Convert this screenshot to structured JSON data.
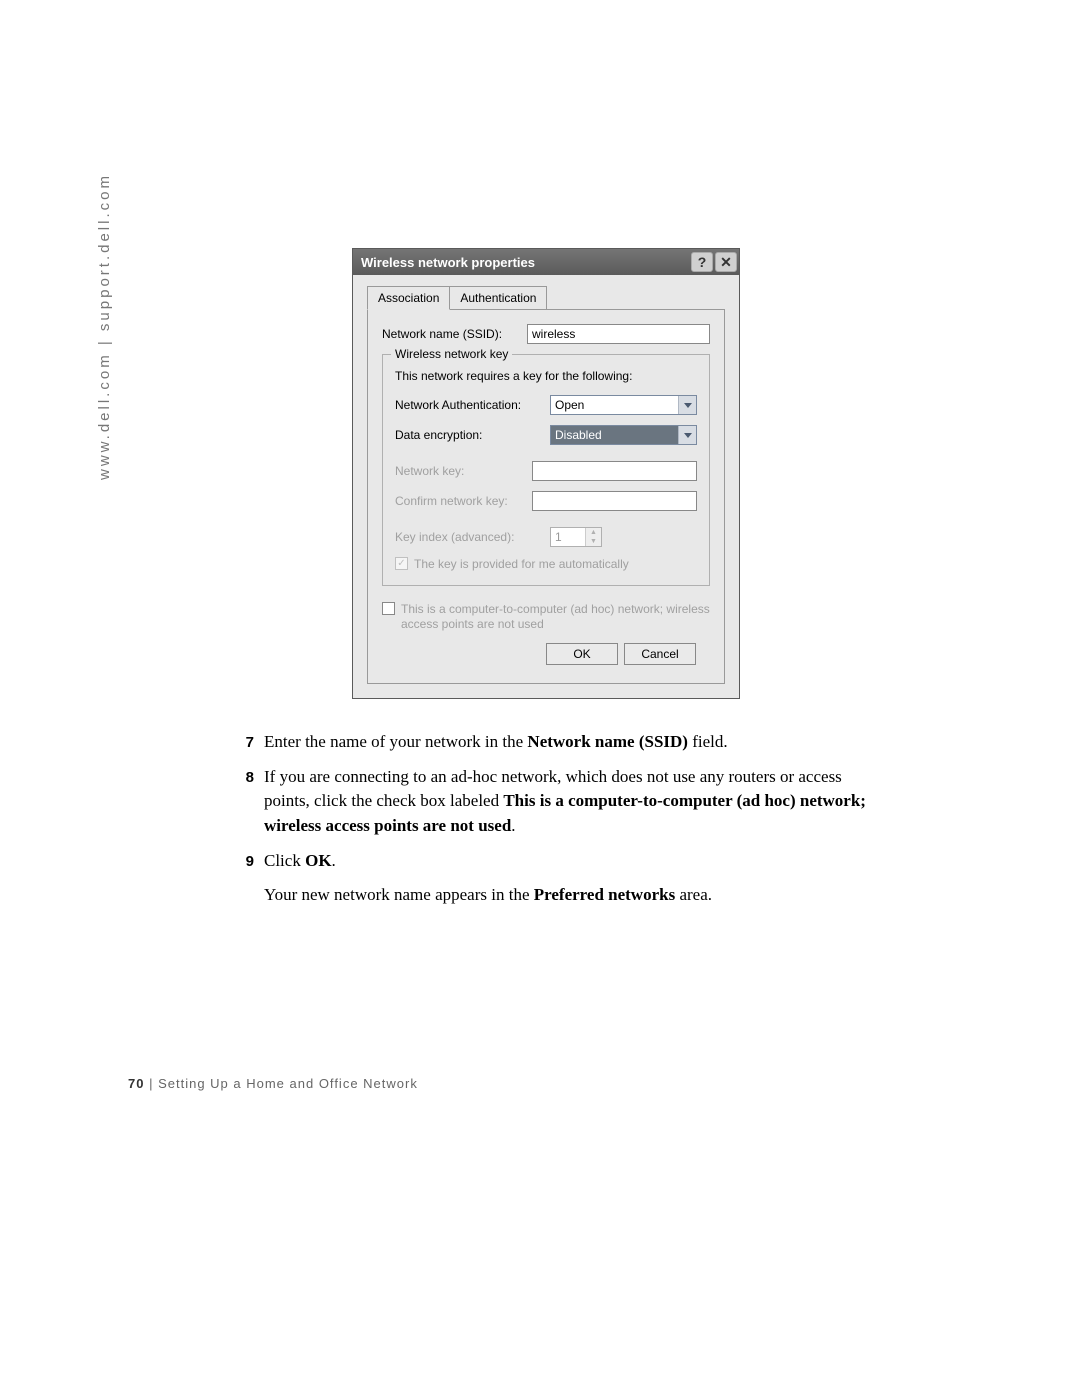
{
  "side_url": "www.dell.com | support.dell.com",
  "dialog": {
    "title": "Wireless network properties",
    "help_glyph": "?",
    "close_glyph": "✕",
    "tabs": {
      "association": "Association",
      "authentication": "Authentication"
    },
    "ssid_label": "Network name (SSID):",
    "ssid_value": "wireless",
    "fieldset_legend": "Wireless network key",
    "requires_text": "This network requires a key for the following:",
    "auth_label": "Network Authentication:",
    "auth_value": "Open",
    "enc_label": "Data encryption:",
    "enc_value": "Disabled",
    "key_label": "Network key:",
    "confirm_key_label": "Confirm network key:",
    "key_index_label": "Key index (advanced):",
    "key_index_value": "1",
    "auto_key_label": "The key is provided for me automatically",
    "adhoc_label": "This is a computer-to-computer (ad hoc) network; wireless access points are not used",
    "ok": "OK",
    "cancel": "Cancel"
  },
  "instructions": {
    "step7_num": "7",
    "step7_a": "Enter the name of your network in the ",
    "step7_b": "Network name (SSID)",
    "step7_c": " field.",
    "step8_num": "8",
    "step8_a": "If you are connecting to an ad-hoc network, which does not use any routers or access points, click the check box labeled ",
    "step8_b": "This is a computer-to-computer (ad hoc) network; wireless access points are not used",
    "step8_c": ".",
    "step9_num": "9",
    "step9_a": "Click ",
    "step9_b": "OK",
    "step9_c": ".",
    "footnote_a": "Your new network name appears in the ",
    "footnote_b": "Preferred networks",
    "footnote_c": " area."
  },
  "footer": {
    "page_num": "70",
    "sep": " | ",
    "section": "Setting Up a Home and Office Network"
  }
}
